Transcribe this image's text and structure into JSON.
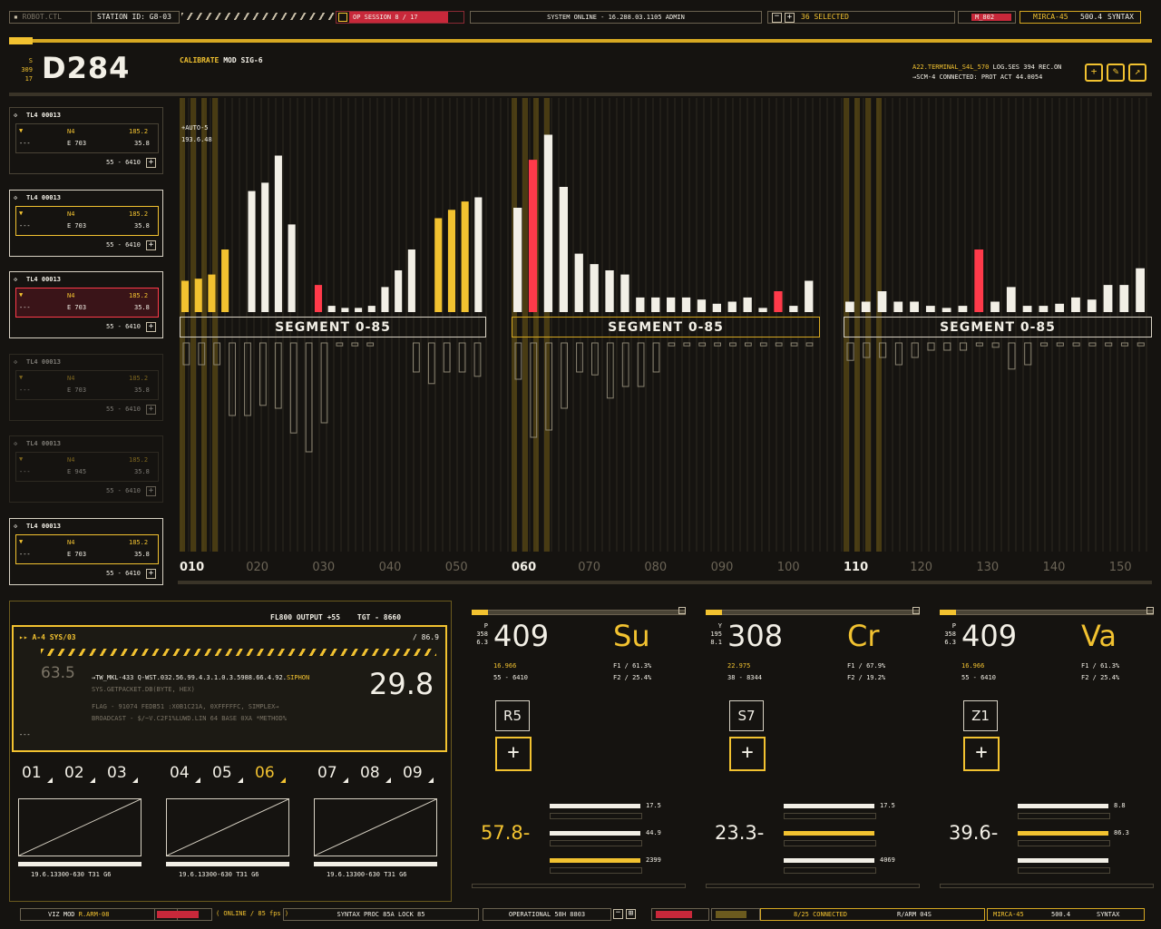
{
  "top_bar": {
    "app_name": "ROBOT.CTL",
    "station": "STATION ID: G8-03",
    "session": "OP SESSION 8 / 17",
    "system_status": "SYSTEM ONLINE - 16.288.03.1105 ADMIN",
    "selected": "36 SELECTED",
    "red_chip": "M_802",
    "unit": "MIRCA-45",
    "value": "500.4",
    "syntax": "SYNTAX"
  },
  "header": {
    "side_nums": [
      "S",
      "309",
      "17"
    ],
    "title": "D284",
    "calibrate": "CALIBRATE",
    "mod": "MOD SIG-6",
    "terminal": "A22.TERMINAL_S4L_570",
    "log": "LOG.SES 394 REC.ON",
    "connected": "→SCM-4 CONNECTED: PROT ACT 44.0054"
  },
  "side_cards": [
    {
      "title": "TL4 00013",
      "code": "N4",
      "val1": "185.2",
      "sub": "E 703",
      "val2": "35.8",
      "range": "55 - 6410",
      "state": "normal"
    },
    {
      "title": "TL4 00013",
      "code": "N4",
      "val1": "185.2",
      "sub": "E 703",
      "val2": "35.8",
      "range": "55 - 6410",
      "state": "active"
    },
    {
      "title": "TL4 00013",
      "code": "N4",
      "val1": "185.2",
      "sub": "E 703",
      "val2": "35.8",
      "range": "55 - 6410",
      "state": "alert"
    },
    {
      "title": "TL4 00013",
      "code": "N4",
      "val1": "185.2",
      "sub": "E 703",
      "val2": "35.8",
      "range": "55 - 6410",
      "state": "dim"
    },
    {
      "title": "TL4 00013",
      "code": "N4",
      "val1": "185.2",
      "sub": "E 945",
      "val2": "35.8",
      "range": "55 - 6410",
      "state": "dim"
    },
    {
      "title": "TL4 00013",
      "code": "N4",
      "val1": "185.2",
      "sub": "E 703",
      "val2": "35.8",
      "range": "55 - 6410",
      "state": "active"
    }
  ],
  "chart": {
    "auto_label": "+AUTO-5",
    "auto_value": "193.6.48",
    "segments": [
      "SEGMENT 0-85",
      "SEGMENT 0-85",
      "SEGMENT 0-85"
    ],
    "ticks": [
      "010",
      "020",
      "030",
      "040",
      "050",
      "060",
      "070",
      "080",
      "090",
      "100",
      "110",
      "120",
      "130",
      "140",
      "150"
    ]
  },
  "chart_data": {
    "type": "bar",
    "segments": [
      {
        "label": "SEGMENT 0-85",
        "up": [
          0.15,
          0.16,
          0.18,
          0.3,
          0,
          0.58,
          0.62,
          0.75,
          0.42,
          0,
          0.13,
          0.03,
          0.02,
          0.02,
          0.03,
          0.12,
          0.2,
          0.3,
          0,
          0.45,
          0.49,
          0.53,
          0.55
        ],
        "up_color": [
          "y",
          "y",
          "y",
          "y",
          "n",
          "w",
          "w",
          "w",
          "w",
          "n",
          "r",
          "w",
          "w",
          "w",
          "w",
          "w",
          "w",
          "w",
          "n",
          "y",
          "y",
          "y",
          "w"
        ],
        "down": [
          0.15,
          0.15,
          0.15,
          0.5,
          0.5,
          0.43,
          0.45,
          0.62,
          0.75,
          0.55,
          0.02,
          0.02,
          0.02,
          0,
          0,
          0.2,
          0.28,
          0.2,
          0.2,
          0.23
        ]
      },
      {
        "label": "SEGMENT 0-85",
        "up": [
          0.5,
          0.73,
          0.85,
          0.6,
          0.28,
          0.23,
          0.2,
          0.18,
          0.07,
          0.07,
          0.07,
          0.07,
          0.06,
          0.04,
          0.05,
          0.07,
          0.02,
          0.1,
          0.03,
          0.15
        ],
        "up_color": [
          "w",
          "r",
          "w",
          "w",
          "w",
          "w",
          "w",
          "w",
          "w",
          "w",
          "w",
          "w",
          "w",
          "w",
          "w",
          "w",
          "w",
          "r",
          "w",
          "w"
        ],
        "down": [
          0.25,
          0.65,
          0.6,
          0.45,
          0.2,
          0.22,
          0.38,
          0.3,
          0.3,
          0.2,
          0.02,
          0.02,
          0.02,
          0.02,
          0.02,
          0.02,
          0.02,
          0.02,
          0.02,
          0.02
        ]
      },
      {
        "label": "SEGMENT 0-85",
        "up": [
          0.05,
          0.05,
          0.1,
          0.05,
          0.05,
          0.03,
          0.02,
          0.03,
          0.3,
          0.05,
          0.12,
          0.03,
          0.03,
          0.04,
          0.07,
          0.06,
          0.13,
          0.13,
          0.21
        ],
        "up_color": [
          "w",
          "w",
          "w",
          "w",
          "w",
          "w",
          "w",
          "w",
          "r",
          "w",
          "w",
          "w",
          "w",
          "w",
          "w",
          "w",
          "w",
          "w",
          "w"
        ],
        "down": [
          0.12,
          0.1,
          0.1,
          0.15,
          0.1,
          0.05,
          0.05,
          0.05,
          0.02,
          0.03,
          0.18,
          0.15,
          0.02,
          0.02,
          0.02,
          0.02,
          0.02,
          0.02,
          0.02
        ]
      }
    ],
    "highlight_columns": [
      "010",
      "060",
      "110"
    ]
  },
  "sys_panel": {
    "output": "FL800 OUTPUT +55",
    "tgt": "TGT - 8660",
    "title": "A-4 SYS/03",
    "ratio": "/ 86.9",
    "value_left": "63.5",
    "value_big": "29.8",
    "line1": "→TW_MKL-433 Q-WST.032.56.99.4.3.1.0.3.5988.66.4.92.",
    "line1_tag": "SIPHON",
    "line2": "SYS.GETPACKET.DB(BYTE, HEX)",
    "line3": "FLAG - 91074 FEDB51 :X0B1C21A, 0XFFFFFC, SIMPLEX→",
    "line4": "BROADCAST - $/~V.C2F1%LUWD.LIN 64 BASE 0XA *METHOD%",
    "dash": "---"
  },
  "channels": {
    "groups": [
      {
        "nums": [
          "01",
          "02",
          "03"
        ],
        "active": -1,
        "caption": "19.6.13300-630 T31 G6"
      },
      {
        "nums": [
          "04",
          "05",
          "06"
        ],
        "active": 2,
        "caption": "19.6.13300-630 T31 G6"
      },
      {
        "nums": [
          "07",
          "08",
          "09"
        ],
        "active": -1,
        "caption": "19.6.13300-630 T31 G6"
      }
    ]
  },
  "elements": [
    {
      "lbl_top": "P",
      "lbl_mid": "358",
      "lbl_bot": "6.3",
      "number": "409",
      "symbol": "Su",
      "v1": "16.966",
      "v2": "55 - 6410",
      "f1": "F1 / 61.3%",
      "f2": "F2 / 25.4%",
      "tag": "R5",
      "readout": "57.8-",
      "bars": [
        {
          "v": "17.5",
          "c": "w",
          "f": 1.0
        },
        {
          "v": "44.9",
          "c": "w",
          "f": 1.0
        },
        {
          "v": "2399",
          "c": "y",
          "f": 1.0
        }
      ]
    },
    {
      "lbl_top": "Y",
      "lbl_mid": "195",
      "lbl_bot": "8.1",
      "number": "308",
      "symbol": "Cr",
      "v1": "22.975",
      "v2": "38 - 8344",
      "f1": "F1 / 67.9%",
      "f2": "F2 / 19.2%",
      "tag": "S7",
      "readout": "23.3-",
      "bars": [
        {
          "v": "17.5",
          "c": "w",
          "f": 1.0
        },
        {
          "v": "",
          "c": "y",
          "f": 1.0
        },
        {
          "v": "4069",
          "c": "w",
          "f": 1.0
        }
      ]
    },
    {
      "lbl_top": "P",
      "lbl_mid": "358",
      "lbl_bot": "6.3",
      "number": "409",
      "symbol": "Va",
      "v1": "16.966",
      "v2": "55 - 6410",
      "f1": "F1 / 61.3%",
      "f2": "F2 / 25.4%",
      "tag": "Z1",
      "readout": "39.6-",
      "bars": [
        {
          "v": "8.8",
          "c": "w",
          "f": 1.0
        },
        {
          "v": "86.3",
          "c": "y",
          "f": 1.0
        },
        {
          "v": "",
          "c": "w",
          "f": 1.0
        }
      ]
    }
  ],
  "bottom_bar": {
    "viz_mod": "VIZ MOD",
    "arm": "R.ARM-08",
    "online": "( ONLINE / 85 fps )",
    "syntax_proc": "SYNTAX PROC 85A LOCK 85",
    "operational": "OPERATIONAL 58H 8803",
    "connected": "8/25 CONNECTED",
    "rarm": "R/ARM 04S",
    "unit": "MIRCA-45",
    "value": "500.4",
    "syntax": "SYNTAX"
  },
  "colors": {
    "accent": "#f2c230",
    "alert": "#ff3a4a",
    "bg": "#151310",
    "text": "#f2efe6"
  }
}
